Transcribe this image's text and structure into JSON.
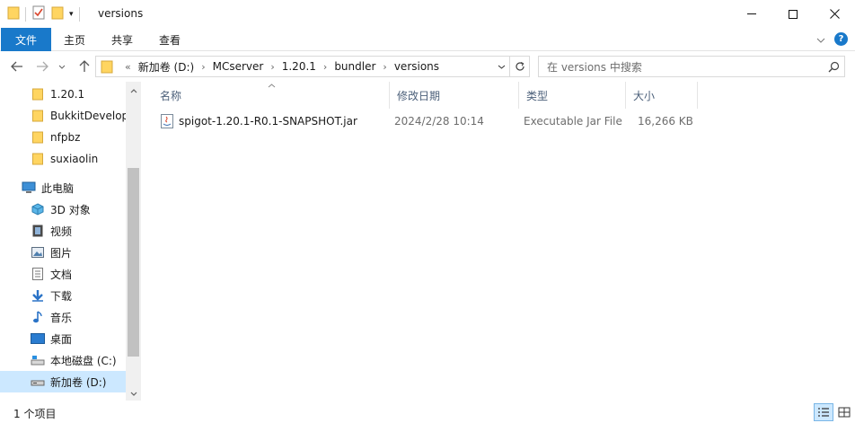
{
  "window": {
    "title": "versions",
    "controls": {
      "minimize": "—",
      "maximize": "☐",
      "close": "✕"
    }
  },
  "ribbon": {
    "tabs": [
      {
        "label": "文件"
      },
      {
        "label": "主页"
      },
      {
        "label": "共享"
      },
      {
        "label": "查看"
      }
    ],
    "expand_icon": "chevron-down-icon",
    "help_label": "?"
  },
  "address": {
    "overflow": "«",
    "crumbs": [
      "新加卷 (D:)",
      "MCserver",
      "1.20.1",
      "bundler",
      "versions"
    ],
    "separator": "›"
  },
  "search": {
    "placeholder": "在 versions 中搜索"
  },
  "nav_pane": {
    "items": [
      {
        "label": "1.20.1",
        "icon": "folder-icon"
      },
      {
        "label": "BukkitDevelop",
        "icon": "folder-icon"
      },
      {
        "label": "nfpbz",
        "icon": "folder-icon"
      },
      {
        "label": "suxiaolin",
        "icon": "folder-icon"
      },
      {
        "label": "此电脑",
        "icon": "computer-icon"
      },
      {
        "label": "3D 对象",
        "icon": "3d-objects-icon"
      },
      {
        "label": "视频",
        "icon": "video-icon"
      },
      {
        "label": "图片",
        "icon": "pictures-icon"
      },
      {
        "label": "文档",
        "icon": "documents-icon"
      },
      {
        "label": "下载",
        "icon": "download-icon"
      },
      {
        "label": "音乐",
        "icon": "music-icon"
      },
      {
        "label": "桌面",
        "icon": "desktop-icon"
      },
      {
        "label": "本地磁盘 (C:)",
        "icon": "drive-icon"
      },
      {
        "label": "新加卷 (D:)",
        "icon": "drive-icon"
      }
    ]
  },
  "columns": {
    "name": "名称",
    "modified": "修改日期",
    "type": "类型",
    "size": "大小"
  },
  "files": [
    {
      "name": "spigot-1.20.1-R0.1-SNAPSHOT.jar",
      "modified": "2024/2/28 10:14",
      "type": "Executable Jar File",
      "size": "16,266 KB",
      "icon": "jar-file-icon"
    }
  ],
  "status": {
    "item_count": "1 个项目"
  },
  "colors": {
    "accent": "#1979ca",
    "selection": "#cce8ff",
    "folder": "#ffd561",
    "header_text": "#4c607a"
  }
}
